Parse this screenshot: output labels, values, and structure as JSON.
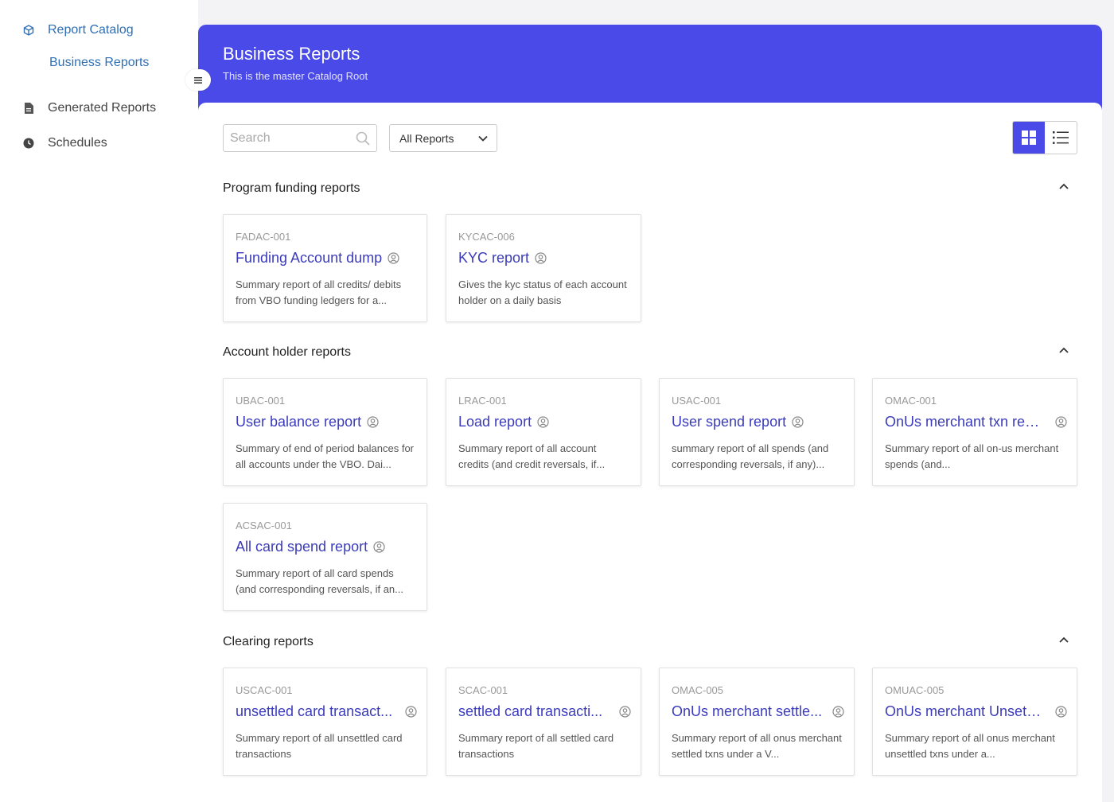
{
  "sidebar": {
    "catalog_label": "Report Catalog",
    "business_label": "Business Reports",
    "generated_label": "Generated Reports",
    "schedules_label": "Schedules"
  },
  "header": {
    "title": "Business Reports",
    "subtitle": "This is the master Catalog Root"
  },
  "toolbar": {
    "search_placeholder": "Search",
    "filter_value": "All Reports",
    "view_mode": "grid"
  },
  "colors": {
    "accent": "#4a4ae8",
    "link": "#3b3bbb",
    "nav_active": "#2f6fb5"
  },
  "sections": [
    {
      "title": "Program funding reports",
      "cards": [
        {
          "code": "FADAC-001",
          "title": "Funding Account dump",
          "desc": "Summary report of all credits/ debits from VBO funding ledgers for a..."
        },
        {
          "code": "KYCAC-006",
          "title": "KYC report",
          "desc": "Gives the kyc status of each account holder on a daily basis"
        }
      ]
    },
    {
      "title": "Account holder reports",
      "cards": [
        {
          "code": "UBAC-001",
          "title": "User balance report",
          "desc": "Summary of end of period balances for all accounts under the VBO. Dai..."
        },
        {
          "code": "LRAC-001",
          "title": "Load report",
          "desc": "Summary report of all account credits (and credit reversals, if..."
        },
        {
          "code": "USAC-001",
          "title": "User spend report",
          "desc": "summary report of all spends (and corresponding reversals, if any)..."
        },
        {
          "code": "OMAC-001",
          "title": "OnUs merchant txn rep...",
          "desc": "Summary report of all on-us merchant spends (and..."
        },
        {
          "code": "ACSAC-001",
          "title": "All card spend report",
          "desc": "Summary report of all card spends (and corresponding reversals, if an..."
        }
      ]
    },
    {
      "title": "Clearing reports",
      "cards": [
        {
          "code": "USCAC-001",
          "title": "unsettled card transact...",
          "desc": "Summary report of all unsettled card transactions"
        },
        {
          "code": "SCAC-001",
          "title": "settled card transacti...",
          "desc": "Summary report of all settled card transactions"
        },
        {
          "code": "OMAC-005",
          "title": "OnUs merchant settle...",
          "desc": "Summary report of all onus merchant settled txns under a V..."
        },
        {
          "code": "OMUAC-005",
          "title": "OnUs merchant Unsettl...",
          "desc": "Summary report of all onus merchant unsettled txns under a..."
        }
      ]
    }
  ]
}
